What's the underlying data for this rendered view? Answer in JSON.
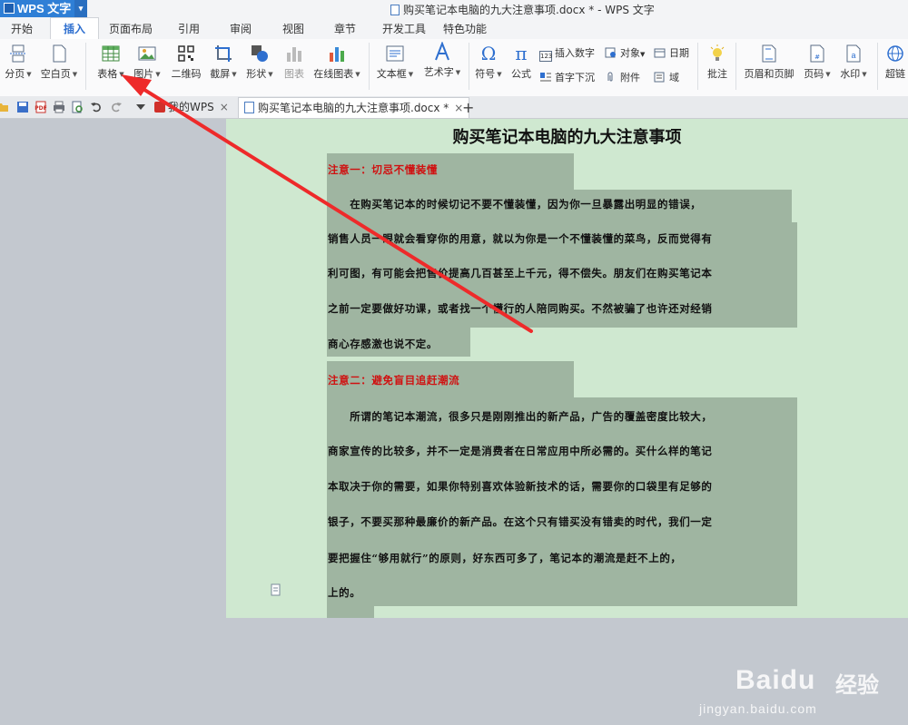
{
  "app": {
    "logo": "WPS 文字",
    "logo_dropdown": "▾",
    "window_title": "购买笔记本电脑的九大注意事项.docx * - WPS 文字"
  },
  "menu": {
    "tabs": [
      "开始",
      "插入",
      "页面布局",
      "引用",
      "审阅",
      "视图",
      "章节",
      "开发工具",
      "特色功能"
    ],
    "active": "插入"
  },
  "ribbon": {
    "page_break": "分页",
    "blank_page": "空白页",
    "table": "表格",
    "picture": "图片",
    "qrcode": "二维码",
    "screenshot": "截屏",
    "shapes": "形状",
    "chart": "图表",
    "online_chart": "在线图表",
    "textbox": "文本框",
    "wordart": "艺术字",
    "symbol": "符号",
    "formula": "公式",
    "insert_number": "插入数字",
    "object": "对象",
    "date": "日期",
    "dropcap": "首字下沉",
    "attachment": "附件",
    "field": "域",
    "comment": "批注",
    "header_footer": "页眉和页脚",
    "page_number": "页码",
    "watermark": "水印",
    "hyperlink": "超链"
  },
  "tabs": {
    "home_tab": "我的WPS",
    "doc_tab": "购买笔记本电脑的九大注意事项.docx *",
    "close": "×",
    "new": "+"
  },
  "document": {
    "title": "购买笔记本电脑的九大注意事项",
    "lines": [
      "注意一：切忌不懂装懂",
      "　　在购买笔记本的时候切记不要不懂装懂，因为你一旦暴露出明显的错误，",
      "销售人员一眼就会看穿你的用意，就以为你是一个不懂装懂的菜鸟，反而觉得有",
      "利可图，有可能会把售价提高几百甚至上千元，得不偿失。朋友们在购买笔记本",
      "之前一定要做好功课，或者找一个懂行的人陪同购买。不然被骗了也许还对经销",
      "商心存感激也说不定。",
      "注意二：避免盲目追赶潮流",
      "　　所谓的笔记本潮流，很多只是刚刚推出的新产品，广告的覆盖密度比较大，",
      "商家宣传的比较多，并不一定是消费者在日常应用中所必需的。买什么样的笔记",
      "本取决于你的需要，如果你特别喜欢体验新技术的话，需要你的口袋里有足够的",
      "银子，不要买那种最廉价的新产品。在这个只有错买没有错卖的时代，我们一定",
      "要把握住“够用就行”的原则，好东西可多了，笔记本的潮流是赶不上的，",
      "上的。"
    ]
  },
  "watermark": {
    "brand": "Baidu",
    "cn": "经验",
    "url": "jingyan.baidu.com"
  },
  "colors": {
    "accent": "#2e6fcf",
    "page_bg": "#cfe8d0",
    "shade": "#9fb5a1",
    "section_title": "#d01010",
    "arrow": "#ee2a2a"
  }
}
